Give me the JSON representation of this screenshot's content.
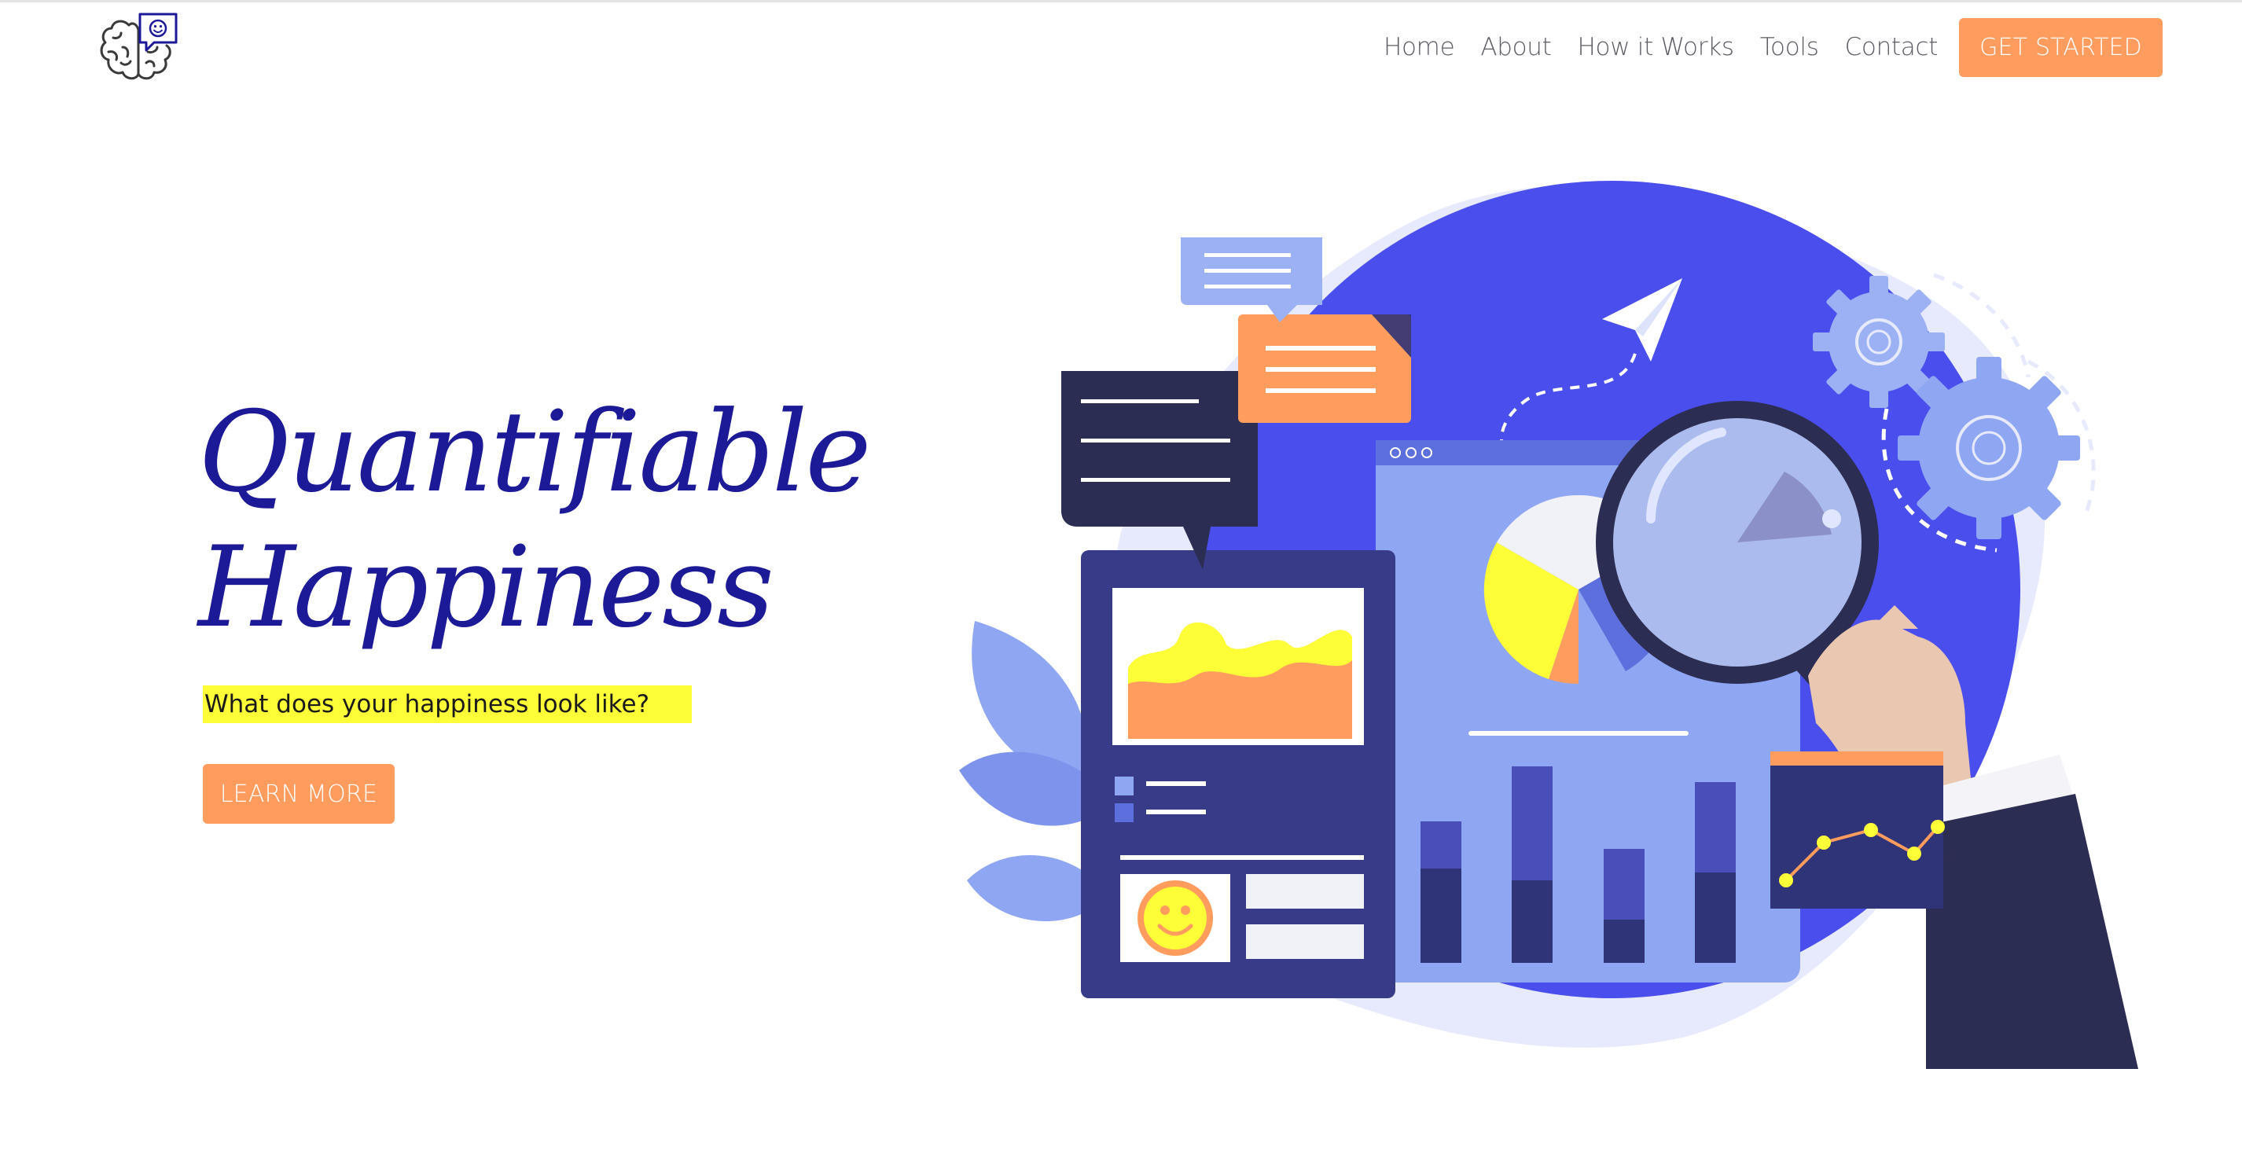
{
  "nav": {
    "links": [
      "Home",
      "About",
      "How it Works",
      "Tools",
      "Contact"
    ],
    "cta_label": "GET STARTED"
  },
  "hero": {
    "title_line1": "Quantifiable",
    "title_line2": "Happiness",
    "subtitle": "What does your happiness look like?",
    "button_label": "LEARN MORE"
  },
  "logo": {
    "icon": "brain-smiley-logo"
  },
  "colors": {
    "accent": "#ff9c5e",
    "title": "#1c1a96",
    "highlight": "#fdfd38",
    "illustration_blue": "#4a4eec"
  }
}
